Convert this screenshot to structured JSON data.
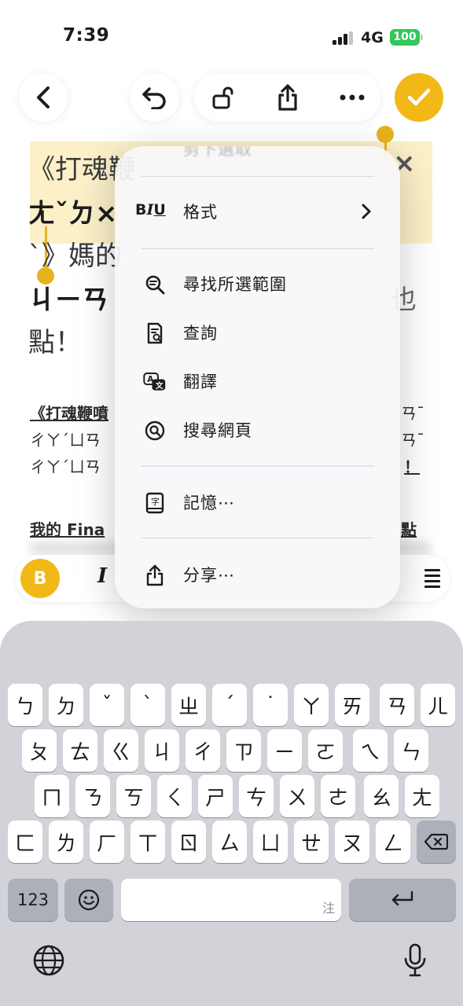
{
  "status_bar": {
    "time": "7:39",
    "network": "4G",
    "battery": "100"
  },
  "toolbar": {
    "back_icon": "chevron-left-icon",
    "undo_icon": "undo-icon",
    "lock_icon": "lock-open-icon",
    "share_icon": "share-icon",
    "more_icon": "ellipsis-icon",
    "done_icon": "checkmark-icon",
    "accent_color": "#f2b817"
  },
  "note": {
    "lines": [
      "《打魂鞭",
      "ㄤˇㄉ×",
      "ˋ》媽的",
      "ㄐㄧㄢ",
      "點！"
    ],
    "right_fragment": "×",
    "right_fragment_2": "也",
    "sub_lines": [
      "《打魂鞭噴",
      "ㄔㄚˊㄩㄢ",
      "ㄔㄚˊㄩㄢ",
      "我的 Fina"
    ],
    "right_sub": [
      "ㄢˉ",
      "ㄢˉ",
      "！",
      "點"
    ],
    "selection_color": "#fbf0c8"
  },
  "format_bar": {
    "bold_label": "B",
    "italic_label": "I",
    "list_icon": "list-icon"
  },
  "context_menu": {
    "top_partial_label": "剪下選取",
    "format": {
      "prefix": "BIU",
      "label": "格式",
      "icon": "text-format-icon"
    },
    "items": [
      {
        "label": "尋找所選範圍",
        "icon": "find-selection-icon"
      },
      {
        "label": "查詢",
        "icon": "lookup-icon"
      },
      {
        "label": "翻譯",
        "icon": "translate-icon"
      },
      {
        "label": "搜尋網頁",
        "icon": "search-web-icon"
      }
    ],
    "memory": {
      "label": "記憶⋯",
      "icon": "dictionary-icon"
    },
    "share": {
      "label": "分享⋯",
      "icon": "share-icon"
    }
  },
  "keyboard": {
    "row1": [
      "ㄅ",
      "ㄉ",
      "ˇ",
      "ˋ",
      "ㄓ",
      "ˊ",
      "˙",
      "ㄚ",
      "ㄞ",
      "ㄢ",
      "ㄦ"
    ],
    "row2": [
      "ㄆ",
      "ㄊ",
      "ㄍ",
      "ㄐ",
      "ㄔ",
      "ㄗ",
      "ㄧ",
      "ㄛ",
      "ㄟ",
      "ㄣ"
    ],
    "row3": [
      "ㄇ",
      "ㄋ",
      "ㄎ",
      "ㄑ",
      "ㄕ",
      "ㄘ",
      "ㄨ",
      "ㄜ",
      "ㄠ",
      "ㄤ"
    ],
    "row4": [
      "ㄈ",
      "ㄌ",
      "ㄏ",
      "ㄒ",
      "ㄖ",
      "ㄙ",
      "ㄩ",
      "ㄝ",
      "ㄡ",
      "ㄥ"
    ],
    "delete_icon": "delete-icon",
    "numbers_label": "123",
    "emoji_icon": "emoji-icon",
    "space_hint": "注",
    "return_icon": "return-icon",
    "globe_icon": "globe-icon",
    "mic_icon": "microphone-icon"
  }
}
